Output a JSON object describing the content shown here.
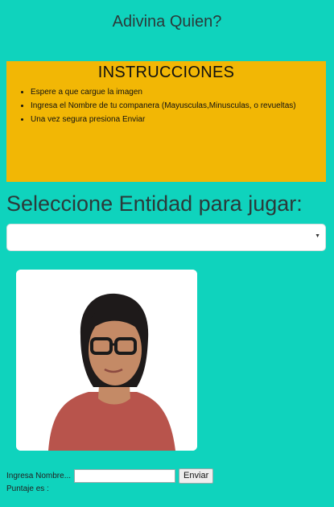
{
  "header": {
    "title": "Adivina Quien?"
  },
  "instructions": {
    "heading": "INSTRUCCIONES",
    "items": [
      "Espere a que cargue la imagen",
      "Ingresa el Nombre de tu companera (Mayusculas,Minusculas, o revueltas)",
      "Una vez segura presiona Enviar"
    ]
  },
  "entity": {
    "heading": "Seleccione Entidad para jugar:",
    "selected": ""
  },
  "photo": {
    "icon": "person-portrait"
  },
  "answer": {
    "label": "Ingresa Nombre...",
    "value": "",
    "button": "Enviar"
  },
  "score": {
    "label": "Puntaje es :"
  },
  "colors": {
    "background": "#0fd3bd",
    "instructions_bg": "#f2b705"
  }
}
